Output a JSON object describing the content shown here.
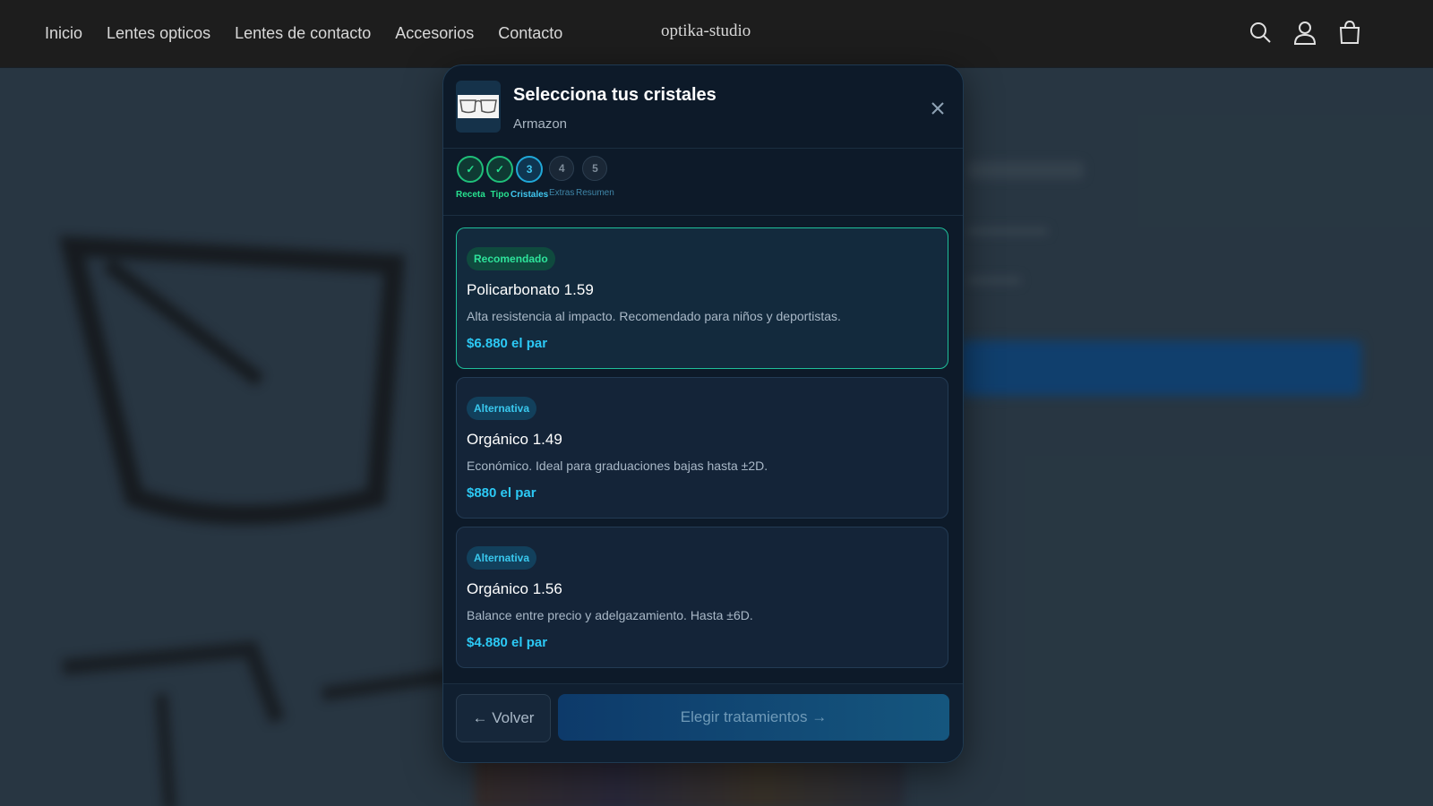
{
  "header": {
    "nav": [
      "Inicio",
      "Lentes opticos",
      "Lentes de contacto",
      "Accesorios",
      "Contacto"
    ],
    "brand": "optika-studio",
    "icons": [
      "search-icon",
      "account-icon",
      "cart-icon"
    ]
  },
  "modal": {
    "title": "Selecciona tus cristales",
    "subtitle": "Armazon",
    "steps": [
      {
        "label": "Receta",
        "marker": "✓",
        "state": "done"
      },
      {
        "label": "Tipo",
        "marker": "✓",
        "state": "done"
      },
      {
        "label": "Cristales",
        "marker": "3",
        "state": "current"
      },
      {
        "label": "Extras",
        "marker": "4",
        "state": "pending"
      },
      {
        "label": "Resumen",
        "marker": "5",
        "state": "pending"
      }
    ],
    "options": [
      {
        "badge": "Recomendado",
        "name": "Policarbonato 1.59",
        "desc": "Alta resistencia al impacto. Recomendado para niños y deportistas.",
        "price": "$6.880 el par",
        "selected": true
      },
      {
        "badge": "Alternativa",
        "name": "Orgánico 1.49",
        "desc": "Económico. Ideal para graduaciones bajas hasta ±2D.",
        "price": "$880 el par",
        "selected": false
      },
      {
        "badge": "Alternativa",
        "name": "Orgánico 1.56",
        "desc": "Balance entre precio y adelgazamiento. Hasta ±6D.",
        "price": "$4.880 el par",
        "selected": false
      }
    ],
    "back_label": "← Volver",
    "next_label": "Elegir tratamientos →"
  },
  "colors": {
    "accent_green": "#2ee39b",
    "accent_cyan": "#2cc9f5",
    "modal_bg": "#0d1a29",
    "header_bg": "#1d1d1d"
  }
}
